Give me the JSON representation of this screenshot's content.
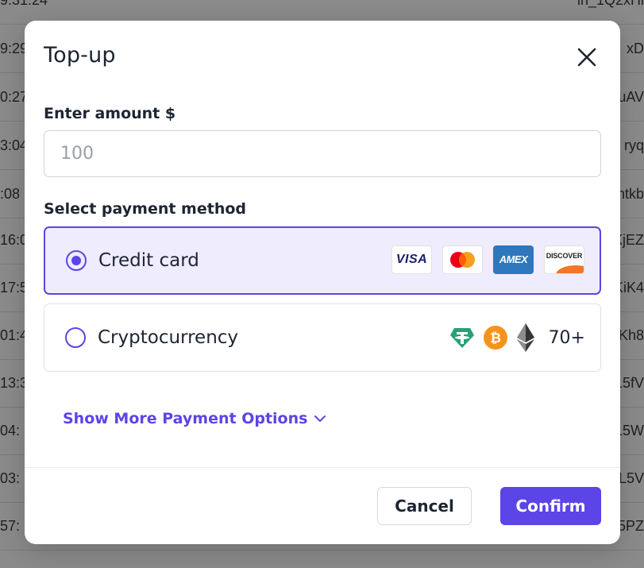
{
  "background": {
    "rows": [
      {
        "left": "9:31:24",
        "right": "in_1Q2xHi"
      },
      {
        "left": "9:29",
        "right": "xD"
      },
      {
        "left": "0:27",
        "right": "uAV"
      },
      {
        "left": "3:04",
        "right": "ryq"
      },
      {
        "left": ":08",
        "right": "ntkb"
      },
      {
        "left": "16:0",
        "right": "XjEZ"
      },
      {
        "left": "17:5",
        "right": "KiK4"
      },
      {
        "left": "01:4",
        "right": "Kh8"
      },
      {
        "left": "13:3",
        "right": "L5fV"
      },
      {
        "left": "04:",
        "right": "L5W"
      },
      {
        "left": "03:",
        "right": "L5V"
      },
      {
        "left": "57:",
        "right": "L5PZ"
      }
    ]
  },
  "modal": {
    "title": "Top-up",
    "amount_label": "Enter amount $",
    "amount_placeholder": "100",
    "payment_label": "Select payment method",
    "methods": [
      {
        "label": "Credit card",
        "selected": true,
        "cards": [
          "VISA",
          "mastercard",
          "AMEX",
          "DISCOVER"
        ]
      },
      {
        "label": "Cryptocurrency",
        "selected": false,
        "extra": "70+"
      }
    ],
    "show_more": "Show More Payment Options",
    "cancel": "Cancel",
    "confirm": "Confirm"
  },
  "colors": {
    "accent": "#5b45e6",
    "selected_bg": "#efecfd"
  },
  "icons": [
    "close-icon",
    "visa-icon",
    "mastercard-icon",
    "amex-icon",
    "discover-icon",
    "tether-icon",
    "bitcoin-icon",
    "ethereum-icon",
    "chevron-down-icon"
  ]
}
